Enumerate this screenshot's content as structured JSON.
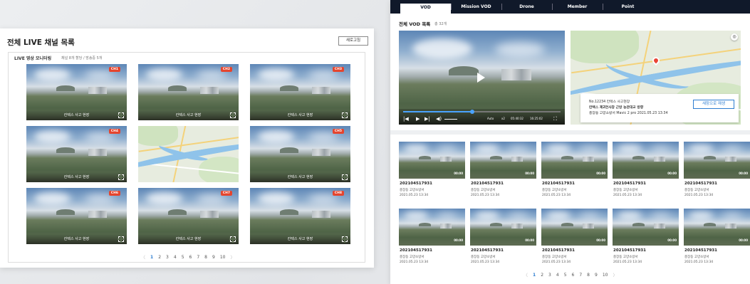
{
  "left_panel": {
    "title": "전체 LIVE 채널 목록",
    "refresh_label": "새로고침",
    "subtitle": "LIVE 영상 모니터링",
    "subinfo": "채널 8개 할당 / 방송중 5개",
    "tiles": [
      {
        "badge": "CH1",
        "caption": "칸텍스 사고 현장",
        "type": "video"
      },
      {
        "badge": "CH2",
        "caption": "칸텍스 사고 현장",
        "type": "video"
      },
      {
        "badge": "CH3",
        "caption": "칸텍스 사고 현장",
        "type": "video"
      },
      {
        "badge": "CH4",
        "caption": "칸텍스 사고 현장",
        "type": "video"
      },
      {
        "badge": "",
        "caption": "",
        "type": "map"
      },
      {
        "badge": "CH5",
        "caption": "칸텍스 사고 현장",
        "type": "video"
      },
      {
        "badge": "CH6",
        "caption": "칸텍스 사고 현장",
        "type": "video"
      },
      {
        "badge": "CH7",
        "caption": "칸텍스 사고 현장",
        "type": "video"
      },
      {
        "badge": "CH8",
        "caption": "칸텍스 사고 현장",
        "type": "video"
      }
    ],
    "pager": {
      "prev": "〈",
      "pages": [
        "1",
        "2",
        "3",
        "4",
        "5",
        "6",
        "7",
        "8",
        "9",
        "10"
      ],
      "current": "1",
      "next": "〉"
    }
  },
  "right_panel": {
    "tabs": [
      "VOD",
      "Mission VOD",
      "Drone",
      "Member",
      "Point"
    ],
    "active_tab": "VOD",
    "title": "전체 VOD 목록",
    "count": "총 32개",
    "player": {
      "speed": "Auto",
      "rate": "x2",
      "current_time": "05:40:32",
      "total_time": "16:25:02",
      "progress": 0.44
    },
    "map_info": {
      "line1": "No.12234  칸텍스 사고현장",
      "line2": "칸텍스 제2연사창 근방 농관대교 방향",
      "line3": "충장동  고양소방서  Mavic 2 pro  2021.05.23  13:34",
      "button": "새창으로 재생"
    },
    "vods": [
      {
        "id": "202104517931",
        "loc": "충장동   고양소방서",
        "date": "2021.05.23  13:34",
        "duration": "00:00"
      },
      {
        "id": "202104517931",
        "loc": "충장동   고양소방서",
        "date": "2021.05.23  13:34",
        "duration": "00:00"
      },
      {
        "id": "202104517931",
        "loc": "충장동   고양소방서",
        "date": "2021.05.23  13:34",
        "duration": "00:00"
      },
      {
        "id": "202104517931",
        "loc": "충장동   고양소방서",
        "date": "2021.05.23  13:34",
        "duration": "00:00"
      },
      {
        "id": "202104517931",
        "loc": "충장동   고양소방서",
        "date": "2021.05.23  13:34",
        "duration": "00:00"
      },
      {
        "id": "202104517931",
        "loc": "충장동   고양소방서",
        "date": "2021.05.23  13:34",
        "duration": "00:00"
      },
      {
        "id": "202104517931",
        "loc": "충장동   고양소방서",
        "date": "2021.05.23  13:34",
        "duration": "00:00"
      },
      {
        "id": "202104517931",
        "loc": "충장동   고양소방서",
        "date": "2021.05.23  13:34",
        "duration": "00:00"
      },
      {
        "id": "202104517931",
        "loc": "충장동   고양소방서",
        "date": "2021.05.23  13:34",
        "duration": "00:00"
      },
      {
        "id": "202104517931",
        "loc": "충장동   고양소방서",
        "date": "2021.05.23  13:34",
        "duration": "00:00"
      }
    ],
    "pager": {
      "prev": "〈",
      "pages": [
        "1",
        "2",
        "3",
        "4",
        "5",
        "6",
        "7",
        "8",
        "9",
        "10"
      ],
      "current": "1",
      "next": "〉"
    }
  },
  "colors": {
    "accent": "#2e7dd1",
    "badge": "#e5452e",
    "navbar": "#10192a"
  },
  "icons": [
    "play-icon",
    "prev-icon",
    "next-icon",
    "volume-icon",
    "fullscreen-icon",
    "locate-icon",
    "chevron-left-icon",
    "chevron-right-icon"
  ]
}
